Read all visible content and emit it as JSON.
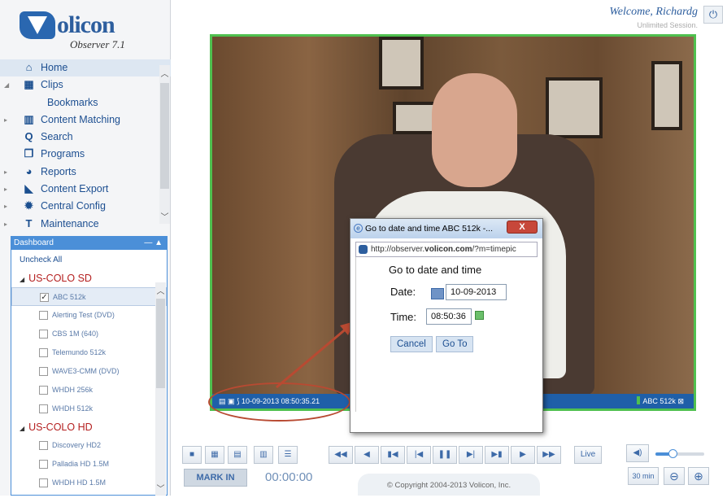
{
  "app": {
    "logo": "olicon",
    "subtitle": "Observer 7.1"
  },
  "header": {
    "welcome": "Welcome, Richardg",
    "session": "Unlimited Session."
  },
  "nav": {
    "items": [
      {
        "label": "Home",
        "icon": "home-icon"
      },
      {
        "label": "Clips",
        "icon": "film-icon"
      },
      {
        "label": "Bookmarks"
      },
      {
        "label": "Content Matching",
        "icon": "content-matching-icon"
      },
      {
        "label": "Search",
        "icon": "search-icon"
      },
      {
        "label": "Programs",
        "icon": "programs-icon"
      },
      {
        "label": "Reports",
        "icon": "pie-chart-icon"
      },
      {
        "label": "Content Export",
        "icon": "export-icon"
      },
      {
        "label": "Central Config",
        "icon": "gear-icon"
      },
      {
        "label": "Maintenance",
        "icon": "tools-icon"
      }
    ]
  },
  "dashboard": {
    "title": "Dashboard",
    "uncheck_all": "Uncheck All",
    "groups": [
      {
        "name": "US-COLO SD",
        "channels": [
          "ABC 512k",
          "Alerting Test (DVD)",
          "CBS 1M (640)",
          "Telemundo 512k",
          "WAVE3-CMM (DVD)",
          "WHDH 256k",
          "WHDH 512k"
        ]
      },
      {
        "name": "US-COLO HD",
        "channels": [
          "Discovery HD2",
          "Palladia HD 1.5M",
          "WHDH HD 1.5M"
        ]
      }
    ],
    "checked": "ABC 512k"
  },
  "video": {
    "timestamp": "10-09-2013 08:50:35.21",
    "channel": "ABC 512k"
  },
  "popup": {
    "window_title": "Go to date and time ABC 512k -...",
    "url_prefix": "http://observer.",
    "url_domain": "volicon.com",
    "url_suffix": "/?m=timepic",
    "heading": "Go to date and time",
    "date_label": "Date:",
    "date_value": "10-09-2013",
    "time_label": "Time:",
    "time_value": "08:50:36",
    "cancel": "Cancel",
    "goto": "Go To",
    "close": "X"
  },
  "controls": {
    "live": "Live",
    "mark_in": "MARK IN",
    "timecode": "00:00:00",
    "zoom_level": "30 min",
    "copyright": "© Copyright 2004-2013 Volicon, Inc.",
    "volume": 0.35
  },
  "colors": {
    "accent": "#4b8fd8",
    "video_border": "#4fc04f",
    "group_text": "#b41f1f"
  }
}
